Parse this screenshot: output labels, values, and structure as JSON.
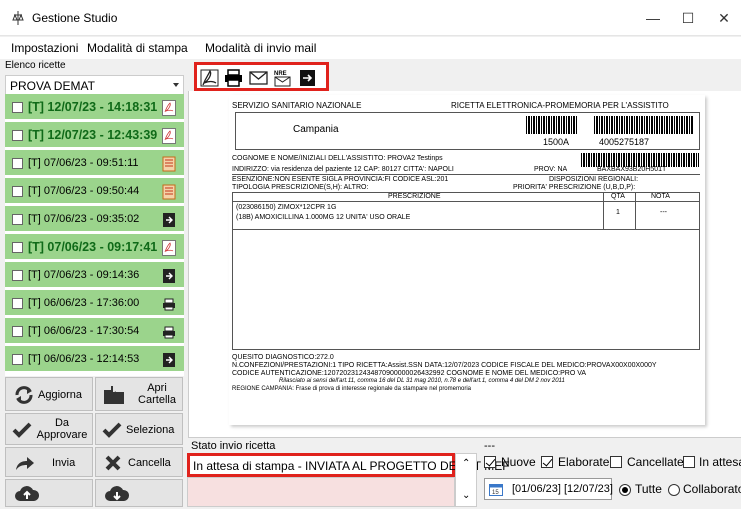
{
  "window": {
    "title": "Gestione Studio",
    "minimize": "—",
    "maximize": "☐",
    "close": "✕"
  },
  "menu": {
    "items": [
      "Impostazioni",
      "Modalità di stampa",
      "Modalità di invio mail"
    ]
  },
  "sidebar": {
    "label": "Elenco ricette",
    "combo_value": "PROVA DEMAT",
    "items": [
      {
        "text": "[T] 12/07/23 - 14:18:31",
        "icon": "pdf-icon"
      },
      {
        "text": "[T] 12/07/23 - 12:43:39",
        "icon": "pdf-icon"
      },
      {
        "text": "[T] 07/06/23 - 09:51:11",
        "icon": "document-icon"
      },
      {
        "text": "[T] 07/06/23 - 09:50:44",
        "icon": "document-icon"
      },
      {
        "text": "[T] 07/06/23 - 09:35:02",
        "icon": "export-icon"
      },
      {
        "text": "[T] 07/06/23 - 09:17:41",
        "icon": "pdf-icon"
      },
      {
        "text": "[T] 07/06/23 - 09:14:36",
        "icon": "export-icon"
      },
      {
        "text": "[T] 06/06/23 - 17:36:00",
        "icon": "printer-icon"
      },
      {
        "text": "[T] 06/06/23 - 17:30:54",
        "icon": "printer-icon"
      },
      {
        "text": "[T] 06/06/23 - 12:14:53",
        "icon": "export-icon"
      }
    ],
    "buttons": {
      "refresh": "Aggiorna",
      "open_folder": "Apri Cartella",
      "to_approve": "Da Approvare",
      "select": "Seleziona",
      "send": "Invia",
      "delete": "Cancella"
    }
  },
  "prescription": {
    "ssn": "SERVIZIO SANITARIO NAZIONALE",
    "header_right": "RICETTA ELETTRONICA-PROMEMORIA PER L'ASSISTITO",
    "region": "Campania",
    "code1": "1500A",
    "code2": "4005275187",
    "patient": "COGNOME E NOME/INIZIALI DELL'ASSISTITO: PROVA2 Testinps",
    "address": "INDIRIZZO: via residenza del paziente 12 CAP: 80127  CITTA': NAPOLI",
    "prov": "PROV: NA",
    "fiscal": "BAXBAX93B20H501T",
    "exemption": "ESENZIONE:NON ESENTE    SIGLA PROVINCIA:FI    CODICE ASL:201",
    "dispositions": "DISPOSIZIONI REGIONALI:",
    "type": "TIPOLOGIA PRESCRIZIONE(S,H):              ALTRO:",
    "priority": "PRIORITA' PRESCRIZIONE (U,B,D,P):",
    "col_prescr": "PRESCRIZIONE",
    "col_qta": "QTA",
    "col_nota": "NOTA",
    "line1": "(023086150) ZIMOX*12CPR 1G",
    "line2": "(18B) AMOXICILLINA 1.000MG 12 UNITA' USO ORALE",
    "qta": "1",
    "nota": "---",
    "quesito": "QUESITO DIAGNOSTICO:272.0",
    "footer1": "N.CONFEZIONI/PRESTAZIONI:1    TIPO RICETTA:Assist.SSN  DATA:12/07/2023    CODICE FISCALE DEL MEDICO:PROVAX00X00X000Y",
    "footer2": "CODICE AUTENTICAZIONE:1207202312434870900000026432992  COGNOME E NOME DEL MEDICO:PRO VA",
    "footer3": "Rilasciato ai sensi dell'art.11, comma 16 del DL 31 mag 2010, n.78 e dell'art.1, comma 4 del DM 2 nov 2011",
    "footer4": "REGIONE CAMPANIA: Frase di prova di interesse regionale da stampare nel promemoria"
  },
  "status": {
    "label": "Stato invio ricetta",
    "value": "In attesa di stampa - INVIATA AL PROGETTO DEMAT MEF",
    "dash": "---"
  },
  "filters": {
    "nuove": "Nuove",
    "elaborate": "Elaborate",
    "cancellate": "Cancellate",
    "in_attesa": "In attesa",
    "date_range": "[01/06/23] [12/07/23]",
    "tutte": "Tutte",
    "collaboratore": "Collaboratore"
  },
  "colors": {
    "accent_red": "#e0221c",
    "list_green": "#9bd48c"
  }
}
